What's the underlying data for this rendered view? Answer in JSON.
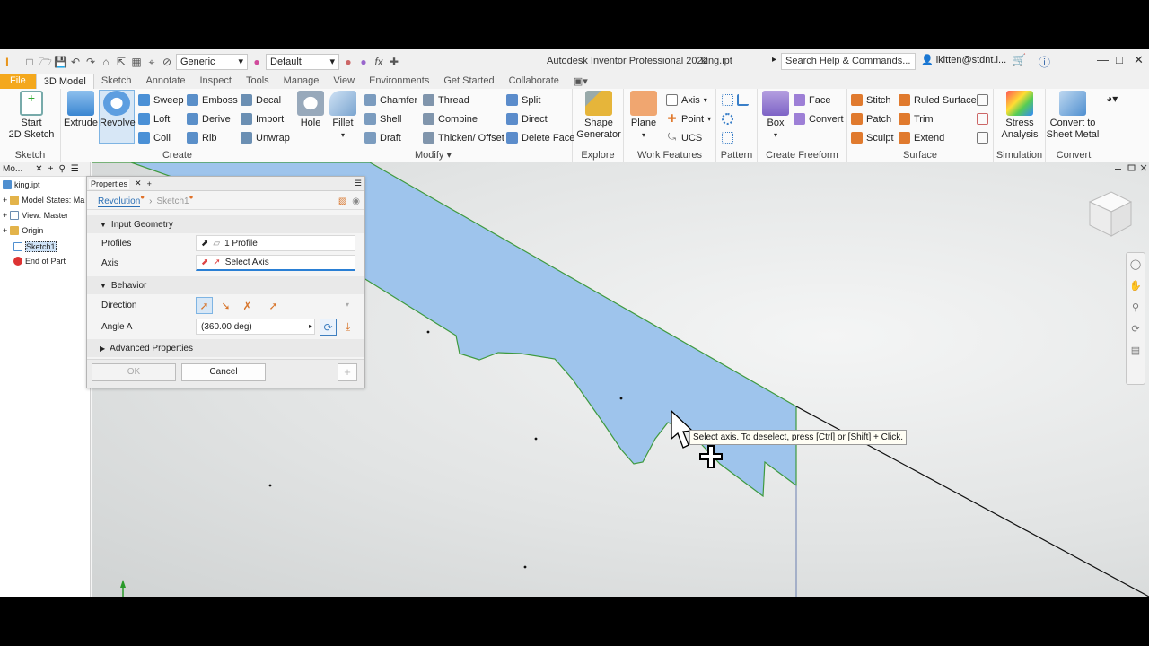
{
  "title_bar": {
    "app_title": "Autodesk Inventor Professional 2022",
    "file_name": "king.ipt",
    "material_combo": "Generic",
    "appearance_combo": "Default",
    "search_placeholder": "Search Help & Commands...",
    "user_name": "lkitten@stdnt.l..."
  },
  "tabs": [
    "File",
    "3D Model",
    "Sketch",
    "Annotate",
    "Inspect",
    "Tools",
    "Manage",
    "View",
    "Environments",
    "Get Started",
    "Collaborate"
  ],
  "ribbon": {
    "sketch": {
      "start_sketch": "Start",
      "start_sketch_2": "2D Sketch",
      "label": "Sketch"
    },
    "create": {
      "extrude": "Extrude",
      "revolve": "Revolve",
      "sweep": "Sweep",
      "loft": "Loft",
      "coil": "Coil",
      "emboss": "Emboss",
      "derive": "Derive",
      "rib": "Rib",
      "decal": "Decal",
      "import": "Import",
      "unwrap": "Unwrap",
      "label": "Create"
    },
    "modify": {
      "hole": "Hole",
      "fillet": "Fillet",
      "chamfer": "Chamfer",
      "shell": "Shell",
      "draft": "Draft",
      "thread": "Thread",
      "combine": "Combine",
      "thicken": "Thicken/ Offset",
      "split": "Split",
      "direct": "Direct",
      "delete_face": "Delete Face",
      "label": "Modify"
    },
    "explore": {
      "shape_generator": "Shape",
      "shape_generator_2": "Generator",
      "label": "Explore"
    },
    "work_features": {
      "plane": "Plane",
      "axis": "Axis",
      "point": "Point",
      "ucs": "UCS",
      "label": "Work Features"
    },
    "pattern": {
      "label": "Pattern"
    },
    "create_freeform": {
      "box": "Box",
      "face": "Face",
      "convert": "Convert",
      "label": "Create Freeform"
    },
    "surface": {
      "stitch": "Stitch",
      "patch": "Patch",
      "sculpt": "Sculpt",
      "ruled_surface": "Ruled Surface",
      "trim": "Trim",
      "extend": "Extend",
      "label": "Surface"
    },
    "simulation": {
      "stress": "Stress",
      "stress_2": "Analysis",
      "label": "Simulation"
    },
    "convert": {
      "sheet_metal": "Convert to",
      "sheet_metal_2": "Sheet Metal",
      "label": "Convert"
    }
  },
  "browser": {
    "tab_label": "Mo...",
    "nodes": [
      "king.ipt",
      "Model States: Ma",
      "View: Master",
      "Origin",
      "Sketch1",
      "End of Part"
    ]
  },
  "properties": {
    "tab_label": "Properties",
    "breadcrumb_feature": "Revolution",
    "breadcrumb_sketch": "Sketch1",
    "input_geometry": "Input Geometry",
    "profiles_label": "Profiles",
    "profiles_value": "1 Profile",
    "axis_label": "Axis",
    "axis_value": "Select Axis",
    "behavior": "Behavior",
    "direction_label": "Direction",
    "angle_label": "Angle A",
    "angle_value": "(360.00 deg)",
    "advanced": "Advanced Properties",
    "ok": "OK",
    "cancel": "Cancel"
  },
  "tooltip": "Select axis. To deselect, press [Ctrl] or [Shift] + Click.",
  "colors": {
    "file_tab": "#f4a81d",
    "profile_fill": "#9ec4ec",
    "profile_edge": "#3f9a3f",
    "highlight": "#cfe3f7"
  }
}
